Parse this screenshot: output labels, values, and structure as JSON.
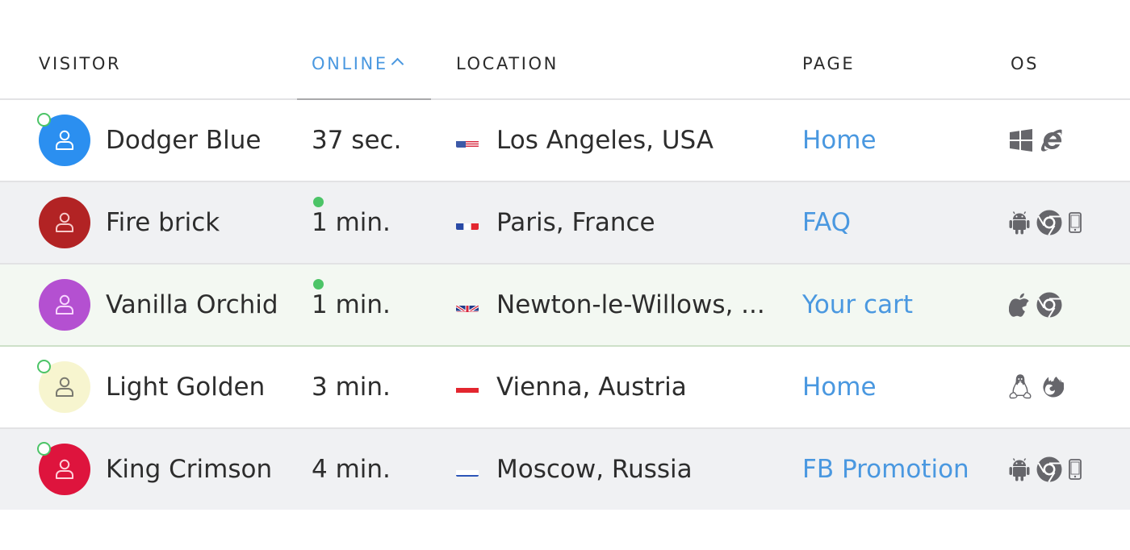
{
  "columns": {
    "visitor": "VISITOR",
    "online": "ONLINE",
    "location": "LOCATION",
    "page": "PAGE",
    "os": "OS"
  },
  "sort": {
    "column": "online",
    "direction": "ascending",
    "accent": "#4a98e0"
  },
  "rows": [
    {
      "name": "Dodger Blue",
      "avatar_color": "#2b8ff0",
      "avatar_icon_color": "#ffffff",
      "status": "away",
      "online": "37 sec.",
      "flag": "us-flag-icon",
      "location": "Los Angeles, USA",
      "page": "Home",
      "os_icons": [
        "windows-icon",
        "internet-explorer-icon"
      ],
      "highlight": "none"
    },
    {
      "name": "Fire brick",
      "avatar_color": "#b22324",
      "avatar_icon_color": "#f6c9c9",
      "status": "online",
      "online": "1 min.",
      "flag": "fr-flag-icon",
      "location": "Paris, France",
      "page": "FAQ",
      "os_icons": [
        "android-icon",
        "chrome-icon",
        "mobile-phone-icon"
      ],
      "highlight": "alt"
    },
    {
      "name": "Vanilla Orchid",
      "avatar_color": "#b450d1",
      "avatar_icon_color": "#f8d6ff",
      "status": "online",
      "online": "1 min.",
      "flag": "gb-flag-icon",
      "location": "Newton-le-Willows, ...",
      "page": "Your cart",
      "os_icons": [
        "apple-icon",
        "chrome-icon"
      ],
      "highlight": "active"
    },
    {
      "name": "Light Golden",
      "avatar_color": "#f7f5cf",
      "avatar_icon_color": "#7a7a70",
      "status": "away",
      "online": "3 min.",
      "flag": "at-flag-icon",
      "location": "Vienna, Austria",
      "page": "Home",
      "os_icons": [
        "linux-icon",
        "firefox-icon"
      ],
      "highlight": "none"
    },
    {
      "name": "King Crimson",
      "avatar_color": "#de143d",
      "avatar_icon_color": "#ffd0da",
      "status": "away",
      "online": "4 min.",
      "flag": "ru-flag-icon",
      "location": "Moscow, Russia",
      "page": "FB Promotion",
      "os_icons": [
        "android-icon",
        "chrome-icon",
        "mobile-phone-icon"
      ],
      "highlight": "alt"
    }
  ]
}
